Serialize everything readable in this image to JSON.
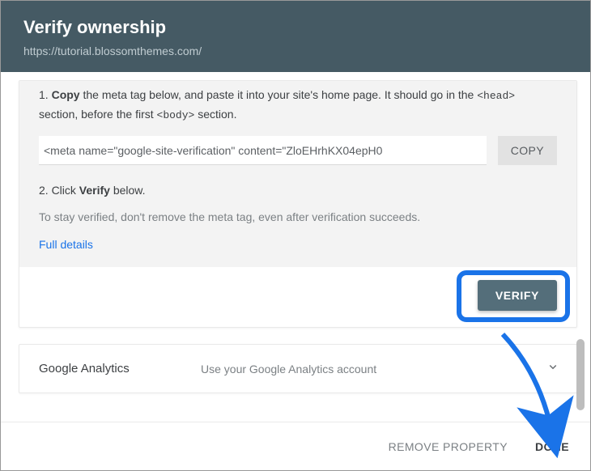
{
  "header": {
    "title": "Verify ownership",
    "url": "https://tutorial.blossomthemes.com/"
  },
  "step1": {
    "prefix": "1. ",
    "bold": "Copy",
    "rest1": " the meta tag below, and paste it into your site's home page. It should go in the ",
    "code1": "<head>",
    "mid": " section, before the first ",
    "code2": "<body>",
    "tail": " section."
  },
  "meta_tag_value": "<meta name=\"google-site-verification\" content=\"ZloEHrhKX04epH0",
  "copy_label": "COPY",
  "step2": {
    "prefix": "2. Click ",
    "bold": "Verify",
    "tail": " below."
  },
  "note": "To stay verified, don't remove the meta tag, even after verification succeeds.",
  "full_details": "Full details",
  "verify_label": "VERIFY",
  "ga": {
    "name": "Google Analytics",
    "desc": "Use your Google Analytics account"
  },
  "footer": {
    "remove": "REMOVE PROPERTY",
    "done": "DONE"
  }
}
